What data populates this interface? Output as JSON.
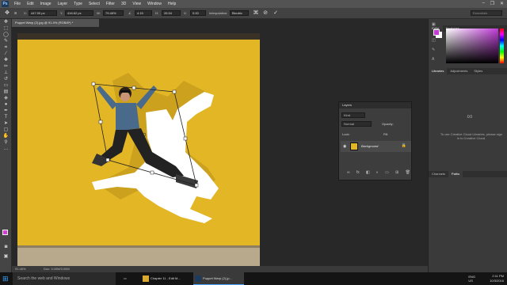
{
  "app": {
    "logo": "Ps"
  },
  "menu": [
    "File",
    "Edit",
    "Image",
    "Layer",
    "Type",
    "Select",
    "Filter",
    "3D",
    "View",
    "Window",
    "Help"
  ],
  "window_controls": [
    "–",
    "❐",
    "✕"
  ],
  "options": {
    "x_value": "447.00 px",
    "y_value": "416.62 px",
    "w_value": "79.46%",
    "angle_value": "4.15",
    "h_skew": "26.94",
    "v_skew": "0.00",
    "interpolation_label": "Interpolation:",
    "interpolation_value": "Bicubic",
    "search_placeholder": "Essentials"
  },
  "document": {
    "tab_title": "Puppet Warp (2).jpg @ 91.4% (RGB/8*) *",
    "status_zoom": "91.46%",
    "status_doc": "Doc: 3.00M/3.00M"
  },
  "panels": {
    "color_tabs": [
      "Color",
      "Swatches"
    ],
    "library_tabs": [
      "Libraries",
      "Adjustments",
      "Styles"
    ],
    "channel_tabs": [
      "Channels",
      "Paths"
    ],
    "cc_message": "To use Creative Cloud Libraries, please sign in to Creative Cloud.",
    "fg_color": "#c23cd2",
    "bg_color": "#ffffff"
  },
  "layers": {
    "title": "Layers",
    "kind_label": "Kind",
    "blend_mode": "Normal",
    "opacity_label": "Opacity:",
    "lock_label": "Lock:",
    "fill_label": "Fill:",
    "layer_name": "Background"
  },
  "taskbar": {
    "search_placeholder": "Search the web and Windows",
    "items": [
      "Chapter 11 - Edit M...",
      "Puppet Warp (2).jp..."
    ],
    "lang": "ENG",
    "region": "US",
    "time": "2:11 PM",
    "date": "10/3/2016"
  },
  "colors": {
    "photo_bg": "#e2b625",
    "accent": "#4aa3ff"
  }
}
